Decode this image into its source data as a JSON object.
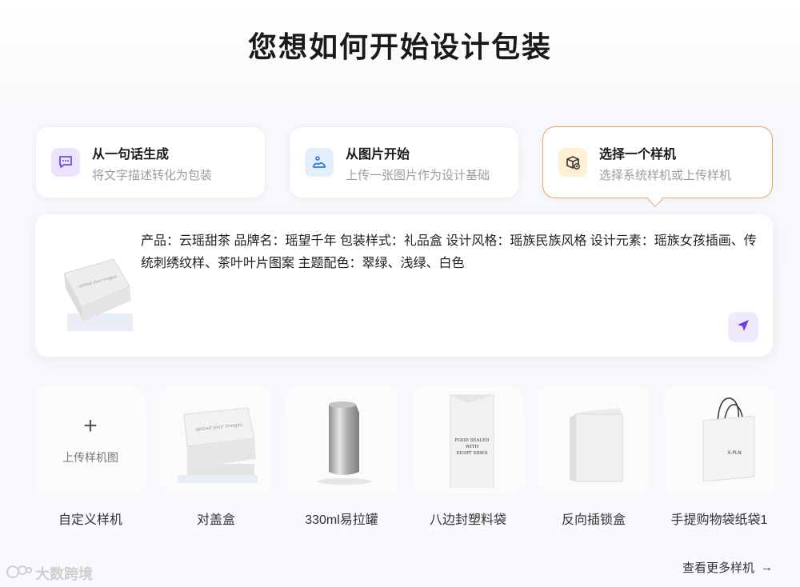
{
  "page": {
    "title": "您想如何开始设计包装"
  },
  "modes": [
    {
      "title": "从一句话生成",
      "desc": "将文字描述转化为包装",
      "icon": "chat-icon",
      "color": "#ece4ff"
    },
    {
      "title": "从图片开始",
      "desc": "上传一张图片作为设计基础",
      "icon": "image-icon",
      "color": "#e2effd"
    },
    {
      "title": "选择一个样机",
      "desc": "选择系统样机或上传样机",
      "icon": "box-icon",
      "color": "#fff0d6",
      "active": true
    }
  ],
  "prompt": {
    "text": "产品：云瑶甜茶 品牌名：瑶望千年 包装样式：礼品盒 设计风格：瑶族民族风格 设计元素：瑶族女孩插画、传统刺绣纹样、茶叶叶片图案 主题配色：翠绿、浅绿、白色",
    "thumb_caption": "upload your images"
  },
  "samples": [
    {
      "label": "自定义样机",
      "icon": "plus-icon"
    },
    {
      "label": "对盖盒",
      "icon": "lid-box-icon",
      "caption": "upload your images"
    },
    {
      "label": "330ml易拉罐",
      "icon": "can-icon"
    },
    {
      "label": "八边封塑料袋",
      "icon": "pouch-icon",
      "caption_lines": [
        "FOOD SEALED",
        "WITH",
        "EIGHT SIDES"
      ]
    },
    {
      "label": "反向插锁盒",
      "icon": "tuck-box-icon"
    },
    {
      "label": "手提购物袋纸袋1",
      "icon": "shopping-bag-icon",
      "caption": "X-PLN"
    }
  ],
  "upload": {
    "plus": "+",
    "text": "上传样机图"
  },
  "more": {
    "label": "查看更多样机",
    "arrow": "→"
  },
  "watermark": {
    "text": "大数跨境"
  },
  "colors": {
    "accent": "#f0a46a",
    "send": "#6a3ee8"
  }
}
